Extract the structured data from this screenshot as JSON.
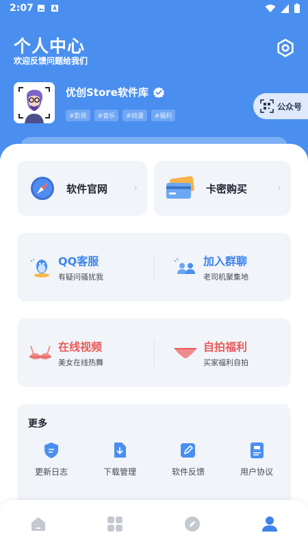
{
  "status": {
    "time": "2:07"
  },
  "header": {
    "title": "个人中心",
    "subtitle": "欢迎反馈问题给我们"
  },
  "profile": {
    "name": "优创Store软件库",
    "tags": [
      "#影视",
      "#音乐",
      "#动漫",
      "#福利"
    ]
  },
  "wechat": {
    "label": "公众号"
  },
  "links": [
    {
      "label": "软件官网"
    },
    {
      "label": "卡密购买"
    }
  ],
  "contact": [
    {
      "title": "QQ客服",
      "desc": "有疑问骚扰我"
    },
    {
      "title": "加入群聊",
      "desc": "老司机聚集地"
    }
  ],
  "media": [
    {
      "title": "在线视频",
      "desc": "美女在线热舞"
    },
    {
      "title": "自拍福利",
      "desc": "买家福利自拍"
    }
  ],
  "more": {
    "title": "更多",
    "items": [
      {
        "label": "更新日志"
      },
      {
        "label": "下载管理"
      },
      {
        "label": "软件反馈"
      },
      {
        "label": "用户协议"
      }
    ]
  },
  "tabs": [
    "home-tab",
    "apps-tab",
    "discover-tab",
    "profile-tab"
  ],
  "colors": {
    "primary": "#4a8ff0",
    "contact_title": "#3d84ea",
    "media_title": "#ea5a5a",
    "tab_active": "#3d84ea",
    "tab_inactive": "#c4c8cf"
  }
}
